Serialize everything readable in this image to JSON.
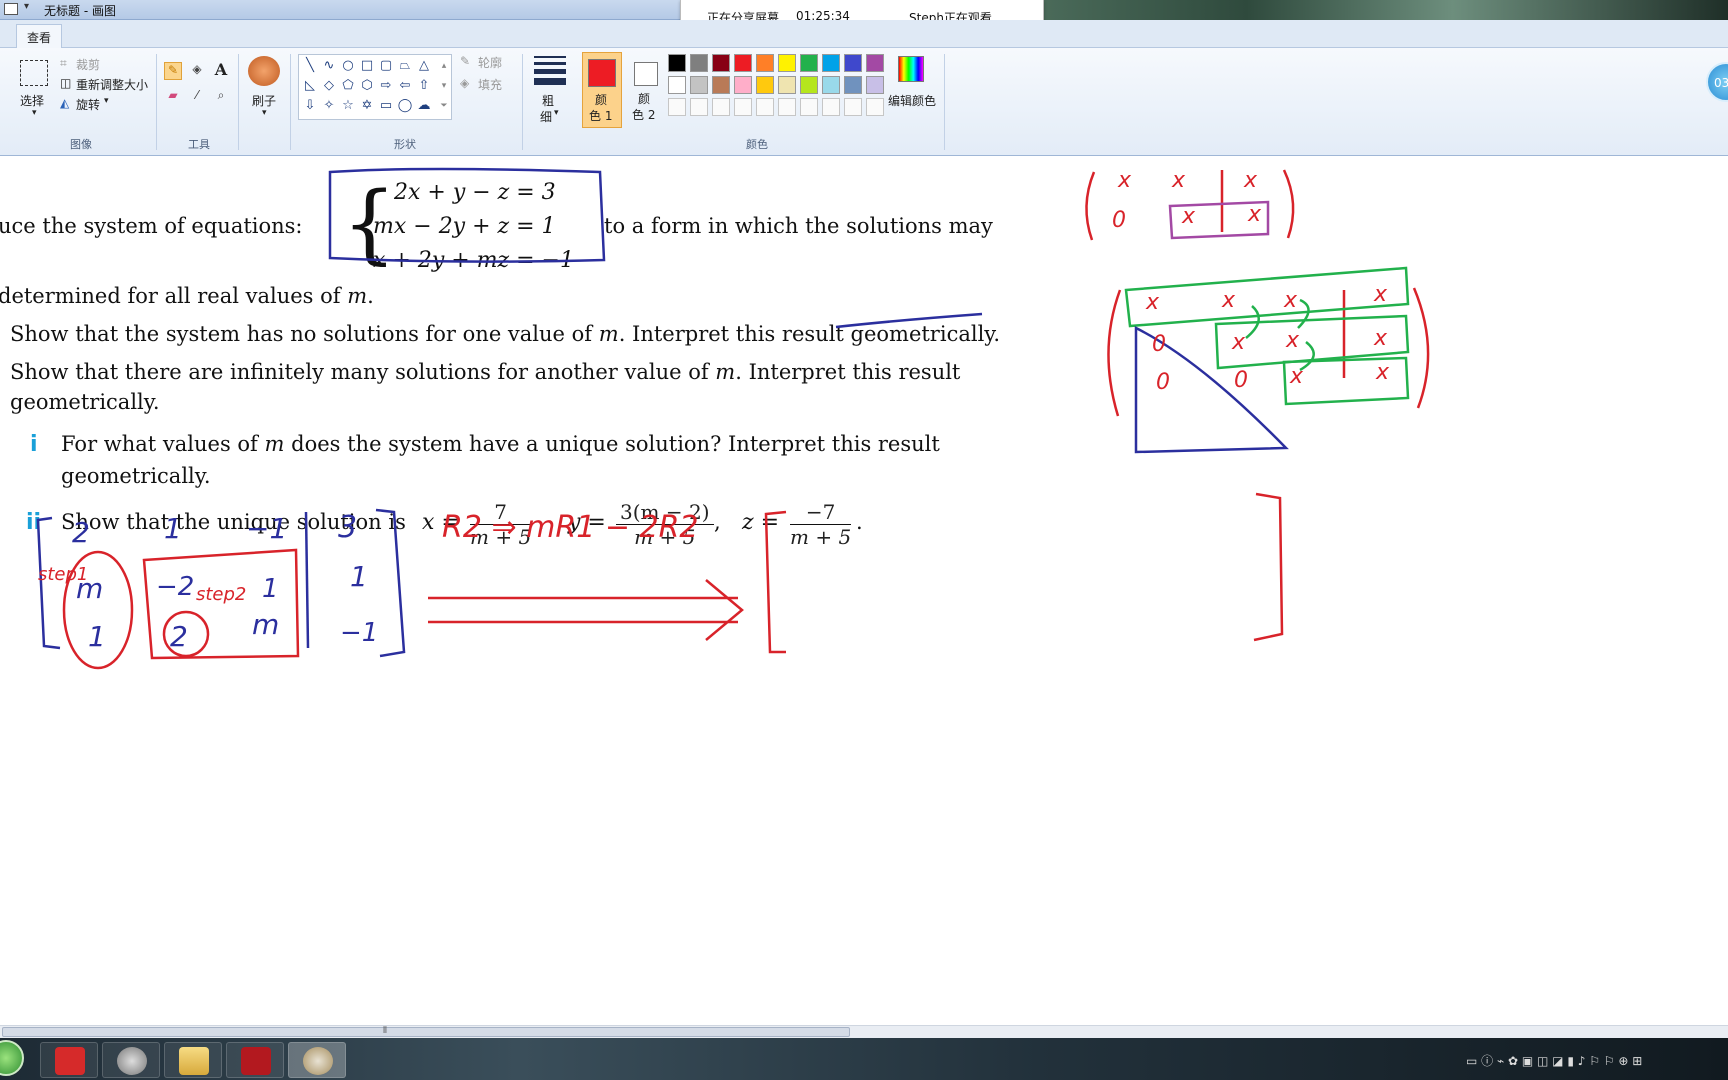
{
  "window": {
    "title": "无标题 - 画图"
  },
  "screenshare": {
    "status": "正在分享屏幕",
    "time": "01:25:34",
    "viewer": "Steph正在观看"
  },
  "ribbon": {
    "tab": "查看",
    "image_group": {
      "select": "选择",
      "crop": "裁剪",
      "resize": "重新调整大小",
      "rotate": "旋转",
      "label": "图像"
    },
    "tools_group": {
      "label": "工具"
    },
    "brush": "刷子",
    "shapes_group": {
      "outline": "轮廓",
      "fill": "填充",
      "label": "形状"
    },
    "size": {
      "line1": "粗",
      "line2": "细"
    },
    "color1": {
      "line1": "颜",
      "line2": "色 1"
    },
    "color2": {
      "line1": "颜",
      "line2": "色 2"
    },
    "edit_colors": "编辑颜色",
    "colors_label": "颜色",
    "avatar_text": "03",
    "palette_row1": [
      "#000000",
      "#7f7f7f",
      "#880015",
      "#ed1c24",
      "#ff7f27",
      "#fff200",
      "#22b14c",
      "#00a2e8",
      "#3f48cc",
      "#a349a4"
    ],
    "palette_row2": [
      "#ffffff",
      "#c3c3c3",
      "#b97a57",
      "#ffaec9",
      "#ffc90e",
      "#efe4b0",
      "#b5e61d",
      "#99d9ea",
      "#7092be",
      "#c8bfe7"
    ],
    "accent_color": "#ed1c24"
  },
  "document": {
    "intro_left": "uce the system of equations:",
    "intro_right": "to a form in which the solutions may",
    "intro_line2": "determined for all real values of",
    "var_m": "m",
    "period": ".",
    "system": [
      "2x + y − z = 3",
      "mx − 2y + z = 1",
      "x + 2y + mz = −1"
    ],
    "q_a_1": "Show that the system has no solutions for one value of",
    "q_a_2": ". Interpret this result geometrically.",
    "q_b_1": "Show that there are infinitely many solutions for another value of",
    "q_b_2": ". Interpret this result",
    "q_b_3": "geometrically.",
    "q_c_num": "i",
    "q_c_1": "For what values of",
    "q_c_2": "does the system have a unique solution? Interpret this result",
    "q_c_3": "geometrically.",
    "q_d_num": "ii",
    "q_d_1": "Show that the unique solution is",
    "x_eq": "x =",
    "x_num": "7",
    "x_den": "m + 5",
    "y_eq": "y =",
    "y_num": "3(m − 2)",
    "y_den": "m + 5",
    "z_eq": "z =",
    "z_num": "−7",
    "z_den": "m + 5",
    "comma": ",",
    "end_period": "."
  },
  "annotations": {
    "matrix": [
      "2",
      "1",
      "−1",
      "3",
      "m",
      "−2",
      "1",
      "1",
      "1",
      "2",
      "m",
      "−1"
    ],
    "step1": "step1",
    "step2": "step2",
    "row_op": "R2 ⇒ mR1 − 2R2",
    "pattern_x": "x",
    "pattern_0": "0"
  }
}
